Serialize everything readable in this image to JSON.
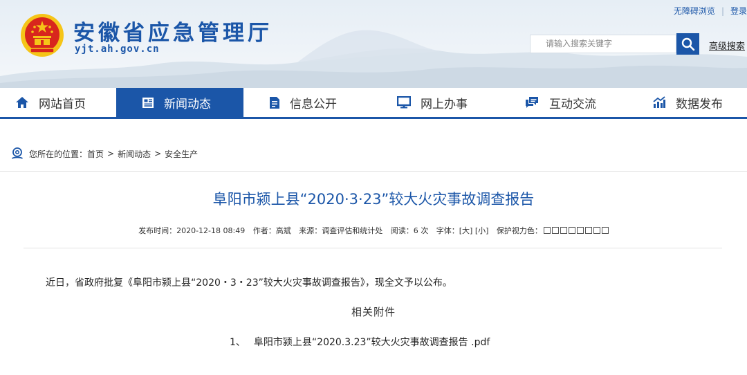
{
  "header": {
    "site_title": "安徽省应急管理厅",
    "site_domain": "yjt.ah.gov.cn",
    "top_links": {
      "accessibility": "无障碍浏览",
      "login": "登录"
    },
    "search": {
      "placeholder": "请输入搜索关键字",
      "advanced_label": "高级搜索"
    }
  },
  "nav": {
    "items": [
      {
        "label": "网站首页",
        "icon": "home-icon"
      },
      {
        "label": "新闻动态",
        "icon": "news-icon",
        "active": true
      },
      {
        "label": "信息公开",
        "icon": "document-icon"
      },
      {
        "label": "网上办事",
        "icon": "monitor-icon"
      },
      {
        "label": "互动交流",
        "icon": "chat-icon"
      },
      {
        "label": "数据发布",
        "icon": "chart-icon"
      }
    ]
  },
  "breadcrumb": {
    "prefix": "您所在的位置：",
    "items": [
      "首页",
      "新闻动态",
      "安全生产"
    ],
    "separator": ">"
  },
  "article": {
    "title": "阜阳市颍上县“2020·3·23”较大火灾事故调查报告",
    "meta": {
      "publish_time": "发布时间：2020-12-18 08:49",
      "author": "作者：高斌",
      "source": "来源：调查评估和统计处",
      "reads": "阅读：6 次",
      "font_size_label": "字体：",
      "font_large": "[大]",
      "font_small": "[小]",
      "eye_protection_label": "保护视力色："
    },
    "body": "近日，省政府批复《阜阳市颍上县“2020・3・23”较大火灾事故调查报告》，现全文予以公布。",
    "attachments_heading": "相关附件",
    "attachments": [
      {
        "number": "1、",
        "name": "阜阳市颍上县“2020.3.23”较大火灾事故调查报告 .pdf"
      }
    ]
  },
  "colors": {
    "brand_blue": "#1b56a8",
    "emblem_red": "#d8261d",
    "emblem_gold": "#f5c518"
  }
}
